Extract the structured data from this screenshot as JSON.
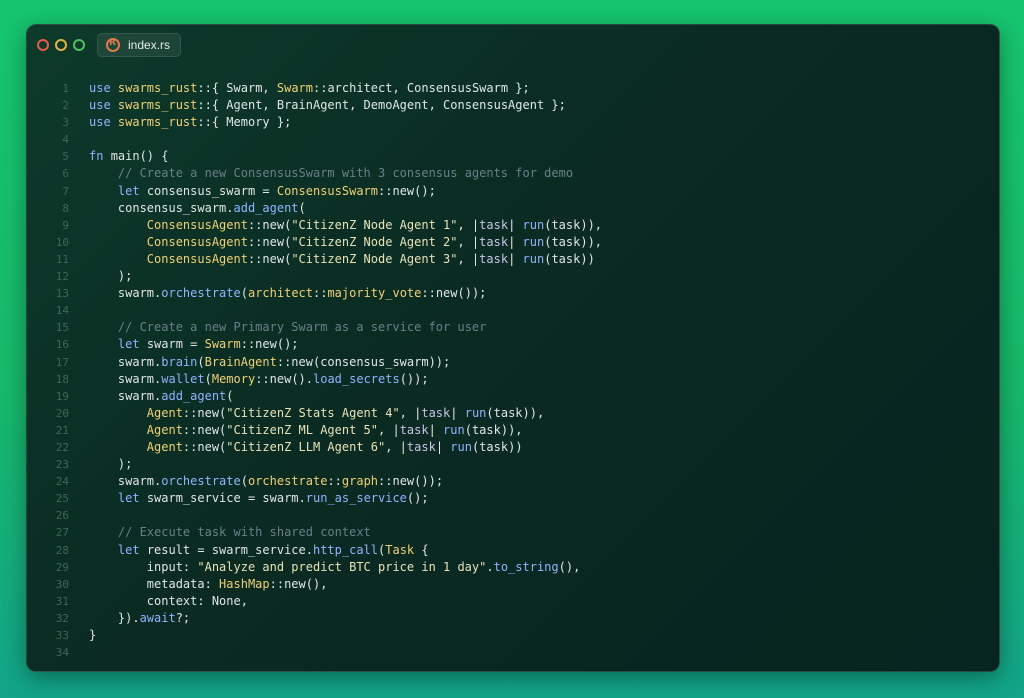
{
  "window": {
    "tab_label": "index.rs",
    "tab_icon": "rust-icon"
  },
  "code": {
    "line_numbers": [
      "1",
      "2",
      "3",
      "4",
      "5",
      "6",
      "7",
      "8",
      "9",
      "10",
      "11",
      "12",
      "13",
      "14",
      "15",
      "16",
      "17",
      "18",
      "19",
      "20",
      "21",
      "22",
      "23",
      "24",
      "25",
      "26",
      "27",
      "28",
      "29",
      "30",
      "31",
      "32",
      "33",
      "34"
    ],
    "lines": [
      [
        [
          "k",
          "use "
        ],
        [
          "t",
          "swarms_rust"
        ],
        [
          "n",
          "::{ Swarm, "
        ],
        [
          "t",
          "Swarm"
        ],
        [
          "n",
          "::architect, ConsensusSwarm };"
        ]
      ],
      [
        [
          "k",
          "use "
        ],
        [
          "t",
          "swarms_rust"
        ],
        [
          "n",
          "::{ Agent, BrainAgent, DemoAgent, ConsensusAgent };"
        ]
      ],
      [
        [
          "k",
          "use "
        ],
        [
          "t",
          "swarms_rust"
        ],
        [
          "n",
          "::{ Memory };"
        ]
      ],
      [],
      [
        [
          "k",
          "fn "
        ],
        [
          "n",
          "main() {"
        ]
      ],
      [
        [
          "n",
          "    "
        ],
        [
          "c",
          "// Create a new ConsensusSwarm with 3 consensus agents for demo"
        ]
      ],
      [
        [
          "n",
          "    "
        ],
        [
          "k",
          "let "
        ],
        [
          "n",
          "consensus_swarm = "
        ],
        [
          "t",
          "ConsensusSwarm"
        ],
        [
          "n",
          "::new();"
        ]
      ],
      [
        [
          "n",
          "    consensus_swarm."
        ],
        [
          "f",
          "add_agent"
        ],
        [
          "n",
          "("
        ]
      ],
      [
        [
          "n",
          "        "
        ],
        [
          "t",
          "ConsensusAgent"
        ],
        [
          "n",
          "::new("
        ],
        [
          "s",
          "\"CitizenZ Node Agent 1\""
        ],
        [
          "n",
          ", |"
        ],
        [
          "p",
          "task"
        ],
        [
          "n",
          "| "
        ],
        [
          "f",
          "run"
        ],
        [
          "n",
          "(task)),"
        ]
      ],
      [
        [
          "n",
          "        "
        ],
        [
          "t",
          "ConsensusAgent"
        ],
        [
          "n",
          "::new("
        ],
        [
          "s",
          "\"CitizenZ Node Agent 2\""
        ],
        [
          "n",
          ", |"
        ],
        [
          "p",
          "task"
        ],
        [
          "n",
          "| "
        ],
        [
          "f",
          "run"
        ],
        [
          "n",
          "(task)),"
        ]
      ],
      [
        [
          "n",
          "        "
        ],
        [
          "t",
          "ConsensusAgent"
        ],
        [
          "n",
          "::new("
        ],
        [
          "s",
          "\"CitizenZ Node Agent 3\""
        ],
        [
          "n",
          ", |"
        ],
        [
          "p",
          "task"
        ],
        [
          "n",
          "| "
        ],
        [
          "f",
          "run"
        ],
        [
          "n",
          "(task))"
        ]
      ],
      [
        [
          "n",
          "    );"
        ]
      ],
      [
        [
          "n",
          "    swarm."
        ],
        [
          "f",
          "orchestrate"
        ],
        [
          "n",
          "("
        ],
        [
          "v",
          "architect"
        ],
        [
          "n",
          "::"
        ],
        [
          "v",
          "majority_vote"
        ],
        [
          "n",
          "::new());"
        ]
      ],
      [],
      [
        [
          "n",
          "    "
        ],
        [
          "c",
          "// Create a new Primary Swarm as a service for user"
        ]
      ],
      [
        [
          "n",
          "    "
        ],
        [
          "k",
          "let "
        ],
        [
          "n",
          "swarm = "
        ],
        [
          "t",
          "Swarm"
        ],
        [
          "n",
          "::new();"
        ]
      ],
      [
        [
          "n",
          "    swarm."
        ],
        [
          "f",
          "brain"
        ],
        [
          "n",
          "("
        ],
        [
          "t",
          "BrainAgent"
        ],
        [
          "n",
          "::new(consensus_swarm));"
        ]
      ],
      [
        [
          "n",
          "    swarm."
        ],
        [
          "f",
          "wallet"
        ],
        [
          "n",
          "("
        ],
        [
          "t",
          "Memory"
        ],
        [
          "n",
          "::new()."
        ],
        [
          "f",
          "load_secrets"
        ],
        [
          "n",
          "());"
        ]
      ],
      [
        [
          "n",
          "    swarm."
        ],
        [
          "f",
          "add_agent"
        ],
        [
          "n",
          "("
        ]
      ],
      [
        [
          "n",
          "        "
        ],
        [
          "t",
          "Agent"
        ],
        [
          "n",
          "::new("
        ],
        [
          "s",
          "\"CitizenZ Stats Agent 4\""
        ],
        [
          "n",
          ", |"
        ],
        [
          "p",
          "task"
        ],
        [
          "n",
          "| "
        ],
        [
          "f",
          "run"
        ],
        [
          "n",
          "(task)),"
        ]
      ],
      [
        [
          "n",
          "        "
        ],
        [
          "t",
          "Agent"
        ],
        [
          "n",
          "::new("
        ],
        [
          "s",
          "\"CitizenZ ML Agent 5\""
        ],
        [
          "n",
          ", |"
        ],
        [
          "p",
          "task"
        ],
        [
          "n",
          "| "
        ],
        [
          "f",
          "run"
        ],
        [
          "n",
          "(task)),"
        ]
      ],
      [
        [
          "n",
          "        "
        ],
        [
          "t",
          "Agent"
        ],
        [
          "n",
          "::new("
        ],
        [
          "s",
          "\"CitizenZ LLM Agent 6\""
        ],
        [
          "n",
          ", |"
        ],
        [
          "p",
          "task"
        ],
        [
          "n",
          "| "
        ],
        [
          "f",
          "run"
        ],
        [
          "n",
          "(task))"
        ]
      ],
      [
        [
          "n",
          "    );"
        ]
      ],
      [
        [
          "n",
          "    swarm."
        ],
        [
          "f",
          "orchestrate"
        ],
        [
          "n",
          "("
        ],
        [
          "v",
          "orchestrate"
        ],
        [
          "n",
          "::"
        ],
        [
          "v",
          "graph"
        ],
        [
          "n",
          "::new());"
        ]
      ],
      [
        [
          "n",
          "    "
        ],
        [
          "k",
          "let "
        ],
        [
          "n",
          "swarm_service = swarm."
        ],
        [
          "f",
          "run_as_service"
        ],
        [
          "n",
          "();"
        ]
      ],
      [],
      [
        [
          "n",
          "    "
        ],
        [
          "c",
          "// Execute task with shared context"
        ]
      ],
      [
        [
          "n",
          "    "
        ],
        [
          "k",
          "let "
        ],
        [
          "n",
          "result = swarm_service."
        ],
        [
          "f",
          "http_call"
        ],
        [
          "n",
          "("
        ],
        [
          "t",
          "Task"
        ],
        [
          "n",
          " {"
        ]
      ],
      [
        [
          "n",
          "        input: "
        ],
        [
          "s",
          "\"Analyze and predict BTC price in 1 day\""
        ],
        [
          "n",
          "."
        ],
        [
          "f",
          "to_string"
        ],
        [
          "n",
          "(),"
        ]
      ],
      [
        [
          "n",
          "        metadata: "
        ],
        [
          "t",
          "HashMap"
        ],
        [
          "n",
          "::new(),"
        ]
      ],
      [
        [
          "n",
          "        context: None,"
        ]
      ],
      [
        [
          "n",
          "    })."
        ],
        [
          "f",
          "await"
        ],
        [
          "n",
          "?;"
        ]
      ],
      [
        [
          "n",
          "}"
        ]
      ],
      []
    ]
  }
}
